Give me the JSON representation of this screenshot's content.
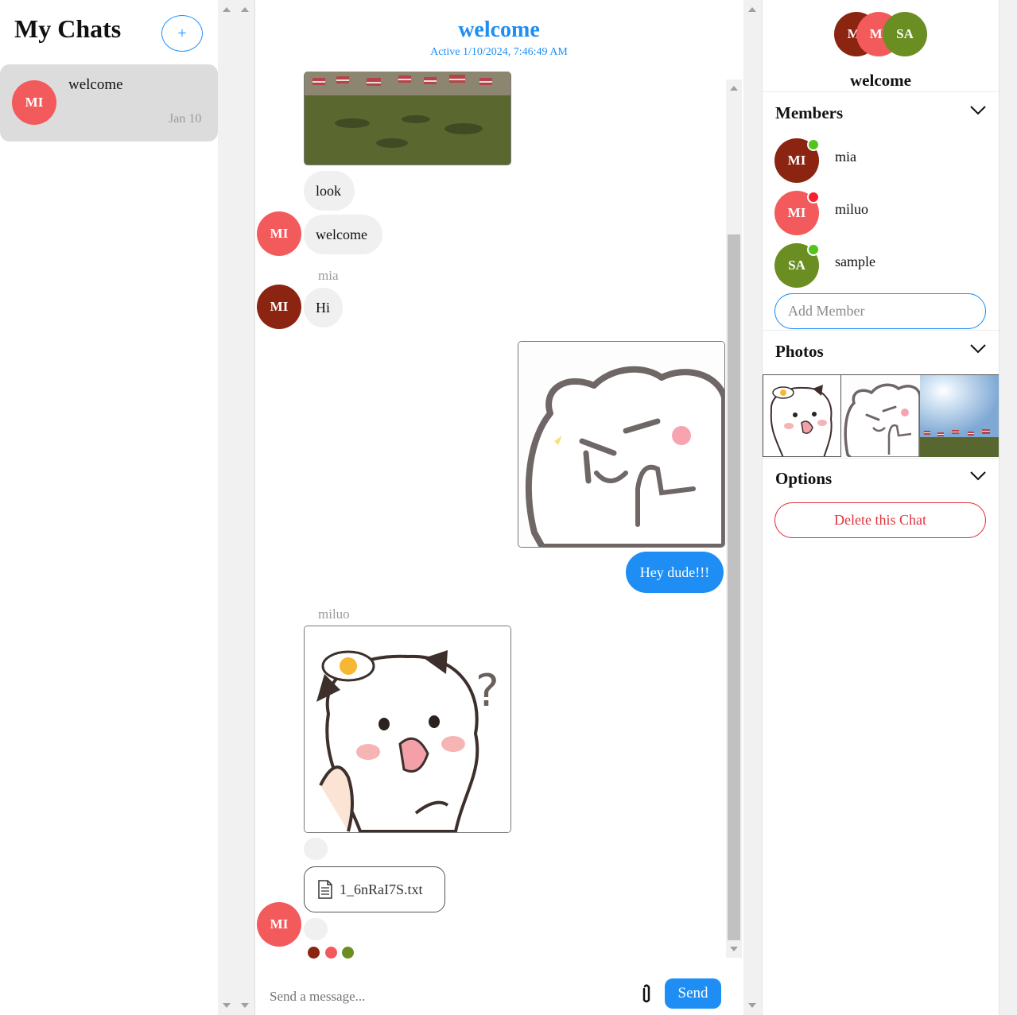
{
  "sidebar": {
    "title": "My Chats",
    "new_chat_label": "+",
    "chats": [
      {
        "initials": "MI",
        "title": "welcome",
        "date": "Jan 10"
      }
    ]
  },
  "chat": {
    "title": "welcome",
    "status": "Active 1/10/2024, 7:46:49 AM",
    "messages": {
      "look": "look",
      "welcome": "welcome",
      "mia_label": "mia",
      "hi": "Hi",
      "hey": "Hey dude!!!",
      "miluo_label": "miluo",
      "file_name": "1_6nRaI7S.txt"
    },
    "avatar_initials": "MI",
    "input_placeholder": "Send a message...",
    "send_label": "Send"
  },
  "details": {
    "title": "welcome",
    "header_avatars": [
      "MI",
      "MI",
      "SA"
    ],
    "members_title": "Members",
    "members": [
      {
        "initials": "MI",
        "name": "mia",
        "color": "#8b2410",
        "online": true
      },
      {
        "initials": "MI",
        "name": "miluo",
        "color": "#f35a5b",
        "online": false
      },
      {
        "initials": "SA",
        "name": "sample",
        "color": "#6b8e23",
        "online": true
      }
    ],
    "add_member_placeholder": "Add Member",
    "photos_title": "Photos",
    "options_title": "Options",
    "delete_label": "Delete this Chat"
  },
  "colors": {
    "accent": "#1e8ef4",
    "mia": "#8b2410",
    "miluo": "#f35a5b",
    "sample": "#6b8e23",
    "online": "#52c41a",
    "offline": "#f5222d",
    "danger": "#e0323c"
  }
}
